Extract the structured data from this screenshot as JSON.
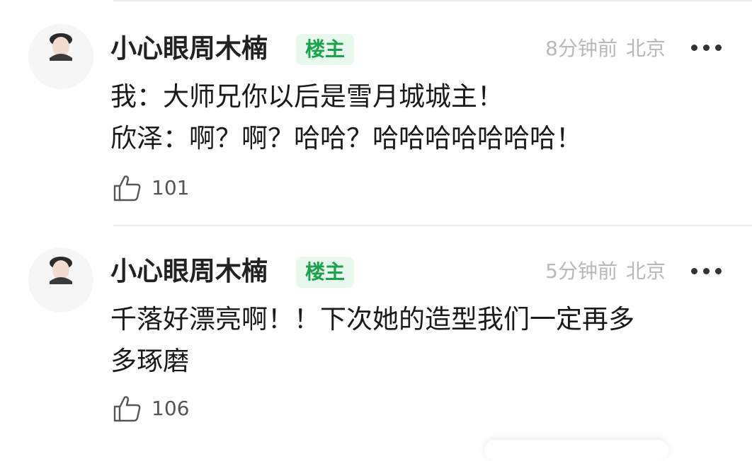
{
  "comments": [
    {
      "username": "小心眼周木楠",
      "badge": "楼主",
      "time": "8分钟前",
      "location": "北京",
      "lines": [
        "我：大师兄你以后是雪月城城主！",
        "欣泽：啊？啊？哈哈？哈哈哈哈哈哈哈！"
      ],
      "likes": "101"
    },
    {
      "username": "小心眼周木楠",
      "badge": "楼主",
      "time": "5分钟前",
      "location": "北京",
      "lines": [
        "千落好漂亮啊！！下次她的造型我们一定再多",
        "多琢磨"
      ],
      "likes": "106"
    }
  ],
  "icons": {
    "avatar": "avatar-icon",
    "more": "more-options-icon",
    "like": "thumbs-up-icon"
  },
  "colors": {
    "badge_text": "#1aa34a",
    "badge_bg": "#e8f8ec",
    "meta_text": "#b8b8b8",
    "divider": "#ececec"
  }
}
